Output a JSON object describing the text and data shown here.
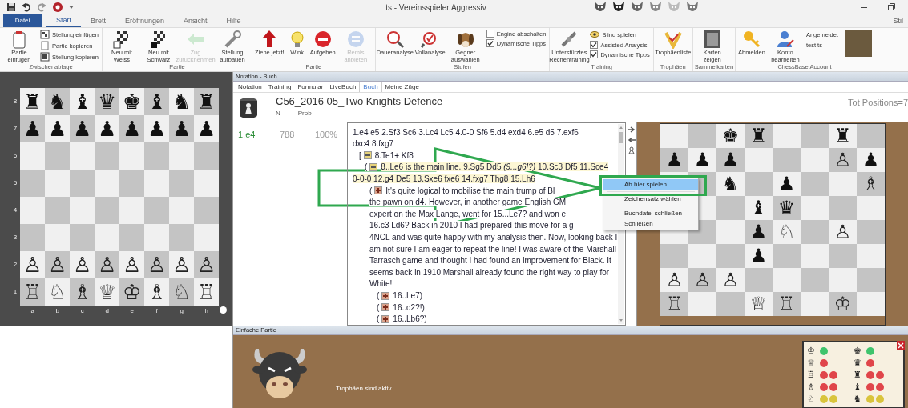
{
  "title_bar": {
    "title": "ts - Vereinsspieler,Aggressiv"
  },
  "ribbon_tabs": [
    {
      "kind": "file",
      "label": "Datei",
      "selected": false
    },
    {
      "kind": "tab",
      "label": "Start",
      "selected": true
    },
    {
      "kind": "tab",
      "label": "Brett",
      "selected": false
    },
    {
      "kind": "tab",
      "label": "Eröffnungen",
      "selected": false
    },
    {
      "kind": "tab",
      "label": "Ansicht",
      "selected": false
    },
    {
      "kind": "tab",
      "label": "Hilfe",
      "selected": false
    }
  ],
  "style_menu": {
    "label": "Stil"
  },
  "ribbon_groups": [
    {
      "title": "Zwischenablage",
      "items": [
        {
          "kind": "large",
          "label": "Partie einfügen",
          "disabled": false
        },
        {
          "kind": "small",
          "label": "Stellung einfügen"
        },
        {
          "kind": "small",
          "label": "Partie kopieren"
        },
        {
          "kind": "small",
          "label": "Stellung kopieren"
        }
      ]
    },
    {
      "title": "Partie",
      "items": [
        {
          "kind": "large",
          "label": "Neu mit Weiss",
          "disabled": false
        },
        {
          "kind": "large",
          "label": "Neu mit Schwarz",
          "disabled": false
        },
        {
          "kind": "large",
          "label": "Zug zurücknehmen",
          "disabled": true
        },
        {
          "kind": "large",
          "label": "Stellung aufbauen",
          "disabled": false
        }
      ]
    },
    {
      "title": "Partie",
      "items": [
        {
          "kind": "large",
          "label": "Ziehe jetzt!",
          "disabled": false
        },
        {
          "kind": "large",
          "label": "Wink",
          "disabled": false
        },
        {
          "kind": "large",
          "label": "Aufgeben",
          "disabled": false
        },
        {
          "kind": "large",
          "label": "Remis anbieten",
          "disabled": true
        }
      ]
    },
    {
      "title": "Stufen",
      "items": [
        {
          "kind": "large",
          "label": "Daueranalyse",
          "disabled": false
        },
        {
          "kind": "large",
          "label": "Vollanalyse",
          "disabled": false
        },
        {
          "kind": "large",
          "label": "Gegner auswählen",
          "disabled": false
        },
        {
          "kind": "check",
          "label": "Engine abschalten",
          "checked": false
        },
        {
          "kind": "check",
          "label": "Dynamische Tipps",
          "checked": true
        }
      ]
    },
    {
      "title": "Training",
      "items": [
        {
          "kind": "large",
          "label": "Unterstütztes Rechentraining",
          "disabled": false
        },
        {
          "kind": "small",
          "label": "Blind spielen"
        },
        {
          "kind": "check",
          "label": "Assisted Analysis",
          "checked": true
        },
        {
          "kind": "check",
          "label": "Dynamische Tipps",
          "checked": true
        }
      ]
    },
    {
      "title": "Trophäen",
      "items": [
        {
          "kind": "large",
          "label": "Trophäenliste",
          "disabled": false
        }
      ]
    },
    {
      "title": "Sammelkarten",
      "items": [
        {
          "kind": "large",
          "label": "Karten zeigen",
          "disabled": false
        }
      ]
    },
    {
      "title": "ChessBase Account",
      "items": [
        {
          "kind": "large",
          "label": "Abmelden",
          "disabled": false
        },
        {
          "kind": "large",
          "label": "Konto bearbeiten",
          "disabled": false
        },
        {
          "kind": "text",
          "label": "Angemeldet"
        },
        {
          "kind": "text",
          "label": "test ts"
        },
        {
          "kind": "photo"
        }
      ]
    }
  ],
  "board_panel": {
    "ranks": [
      "8",
      "7",
      "6",
      "5",
      "4",
      "3",
      "2",
      "1"
    ],
    "files": [
      "a",
      "b",
      "c",
      "d",
      "e",
      "f",
      "g",
      "h"
    ],
    "rows": [
      [
        "♜",
        "♞",
        "♝",
        "♛",
        "♚",
        "♝",
        "♞",
        "♜"
      ],
      [
        "♟",
        "♟",
        "♟",
        "♟",
        "♟",
        "♟",
        "♟",
        "♟"
      ],
      [
        null,
        null,
        null,
        null,
        null,
        null,
        null,
        null
      ],
      [
        null,
        null,
        null,
        null,
        null,
        null,
        null,
        null
      ],
      [
        null,
        null,
        null,
        null,
        null,
        null,
        null,
        null
      ],
      [
        null,
        null,
        null,
        null,
        null,
        null,
        null,
        null
      ],
      [
        "♙",
        "♙",
        "♙",
        "♙",
        "♙",
        "♙",
        "♙",
        "♙"
      ],
      [
        "♖",
        "♘",
        "♗",
        "♕",
        "♔",
        "♗",
        "♘",
        "♖"
      ]
    ],
    "white_to_move": true
  },
  "notation": {
    "title": "Notation - Buch",
    "tabs": [
      {
        "label": "Notation",
        "selected": false
      },
      {
        "label": "Training",
        "selected": false
      },
      {
        "label": "Formular",
        "selected": false
      },
      {
        "label": "LiveBuch",
        "selected": false
      },
      {
        "label": "Buch",
        "selected": true
      },
      {
        "label": "Meine Züge",
        "selected": false
      }
    ],
    "book": {
      "title": "C56_2016 05_Two Knights Defence",
      "columns": [
        "N",
        "Prob"
      ],
      "total": "Tot Positions=7",
      "rows": [
        {
          "move": "1.e4",
          "n": "788",
          "prob": "100%"
        }
      ]
    },
    "lines": [
      {
        "kind": "main",
        "highlight": false,
        "text": "1.e4  e5  2.Sf3  Sc6  3.Lc4  Lc5  4.0-0  Sf6  5.d4  exd4  6.e5  d5  7.exf6"
      },
      {
        "kind": "main",
        "highlight": false,
        "text": "dxc4  8.fxg7"
      },
      {
        "kind": "branch",
        "highlight": false,
        "open": "[",
        "text": "8.Te1+  Kf8"
      },
      {
        "kind": "sub",
        "highlight": true,
        "open": "(",
        "text": "8..Le6 is the main line.  9.Sg5  Dd5  *(9...g6!?)*  10.Sc3  Df5  11.Sce4"
      },
      {
        "kind": "sub_cont",
        "highlight": true,
        "text": "0-0-0  12.g4  De5  13.Sxe6  fxe6  14.fxg7  Thg8  15.Lh6"
      },
      {
        "kind": "note",
        "highlight": false,
        "open": "(",
        "text": "It's quite logical to mobilise the main trump of Bl"
      },
      {
        "kind": "note_cont",
        "highlight": false,
        "text": "the pawn on d4. However, in another game English GM"
      },
      {
        "kind": "note_cont",
        "highlight": false,
        "text": "expert on the Max Lange, went for  15...Le7? and won e"
      },
      {
        "kind": "note_cont",
        "highlight": false,
        "text": "16.c3  Ld6? Back in 2010 I had prepared this move for a g"
      },
      {
        "kind": "note_cont",
        "highlight": false,
        "text": "4NCL and was quite happy with my analysis then. Now, looking back I"
      },
      {
        "kind": "note_cont",
        "highlight": false,
        "text": "am not sure I am eager to repeat the line! I was aware of the Marshall-"
      },
      {
        "kind": "note_cont",
        "highlight": false,
        "text": "Tarrasch game and thought I had found an improvement for Black. It"
      },
      {
        "kind": "note_cont",
        "highlight": false,
        "text": "seems back in 1910 Marshall already found the right way to play for"
      },
      {
        "kind": "note_cont",
        "highlight": false,
        "text": "White!"
      },
      {
        "kind": "leaf",
        "highlight": false,
        "open": "(",
        "text": "16..Le7",
        "close": ")"
      },
      {
        "kind": "leaf",
        "highlight": false,
        "open": "(",
        "text": "16..d2?!",
        "close": ")"
      },
      {
        "kind": "leaf",
        "highlight": false,
        "open": "(",
        "text": "16..Lb6?",
        "close": ")"
      }
    ],
    "context_menu": [
      {
        "kind": "item",
        "label": "Ab hier spielen",
        "selected": true
      },
      {
        "kind": "separator"
      },
      {
        "kind": "item",
        "label": "Zeichensatz wählen",
        "selected": false
      },
      {
        "kind": "separator"
      },
      {
        "kind": "item",
        "label": "Buchdatei schließen",
        "selected": false
      },
      {
        "kind": "item",
        "label": "Schließen",
        "selected": false
      }
    ]
  },
  "analysis_board": {
    "rows": [
      [
        null,
        null,
        "♚",
        "♜",
        null,
        null,
        "♜",
        null
      ],
      [
        "♟",
        "♟",
        "♟",
        null,
        null,
        null,
        "♙",
        "♟"
      ],
      [
        null,
        null,
        "♞",
        null,
        "♟",
        null,
        null,
        "♗"
      ],
      [
        null,
        null,
        null,
        "♝",
        "♛",
        null,
        null,
        null
      ],
      [
        null,
        null,
        null,
        "♟",
        "♘",
        null,
        "♙",
        null
      ],
      [
        null,
        null,
        null,
        "♟",
        null,
        null,
        null,
        null
      ],
      [
        "♙",
        "♙",
        "♙",
        null,
        null,
        null,
        null,
        null
      ],
      [
        "♖",
        null,
        null,
        "♕",
        "♖",
        null,
        "♔",
        null
      ]
    ]
  },
  "game_panel": {
    "title": "Einfache Partie",
    "message": "Trophäen sind aktiv.",
    "material": [
      {
        "white": {
          "piece": "♔",
          "dots": [
            {
              "color": "#3fc46d"
            }
          ]
        },
        "black": {
          "piece": "♚",
          "dots": [
            {
              "color": "#3fc46d"
            }
          ]
        }
      },
      {
        "white": {
          "piece": "♕",
          "dots": [
            {
              "color": "#e0454a"
            }
          ]
        },
        "black": {
          "piece": "♛",
          "dots": [
            {
              "color": "#e0454a"
            }
          ]
        }
      },
      {
        "white": {
          "piece": "♖",
          "dots": [
            {
              "color": "#e0454a"
            },
            {
              "color": "#e0454a"
            }
          ]
        },
        "black": {
          "piece": "♜",
          "dots": [
            {
              "color": "#e0454a"
            },
            {
              "color": "#e0454a"
            }
          ]
        }
      },
      {
        "white": {
          "piece": "♗",
          "dots": [
            {
              "color": "#e0454a"
            },
            {
              "color": "#e0454a"
            }
          ]
        },
        "black": {
          "piece": "♝",
          "dots": [
            {
              "color": "#e0454a"
            },
            {
              "color": "#e0454a"
            }
          ]
        }
      },
      {
        "white": {
          "piece": "♘",
          "dots": [
            {
              "color": "#d9c43c"
            },
            {
              "color": "#d9c43c"
            }
          ]
        },
        "black": {
          "piece": "♞",
          "dots": [
            {
              "color": "#d9c43c"
            },
            {
              "color": "#d9c43c"
            }
          ]
        }
      }
    ]
  }
}
